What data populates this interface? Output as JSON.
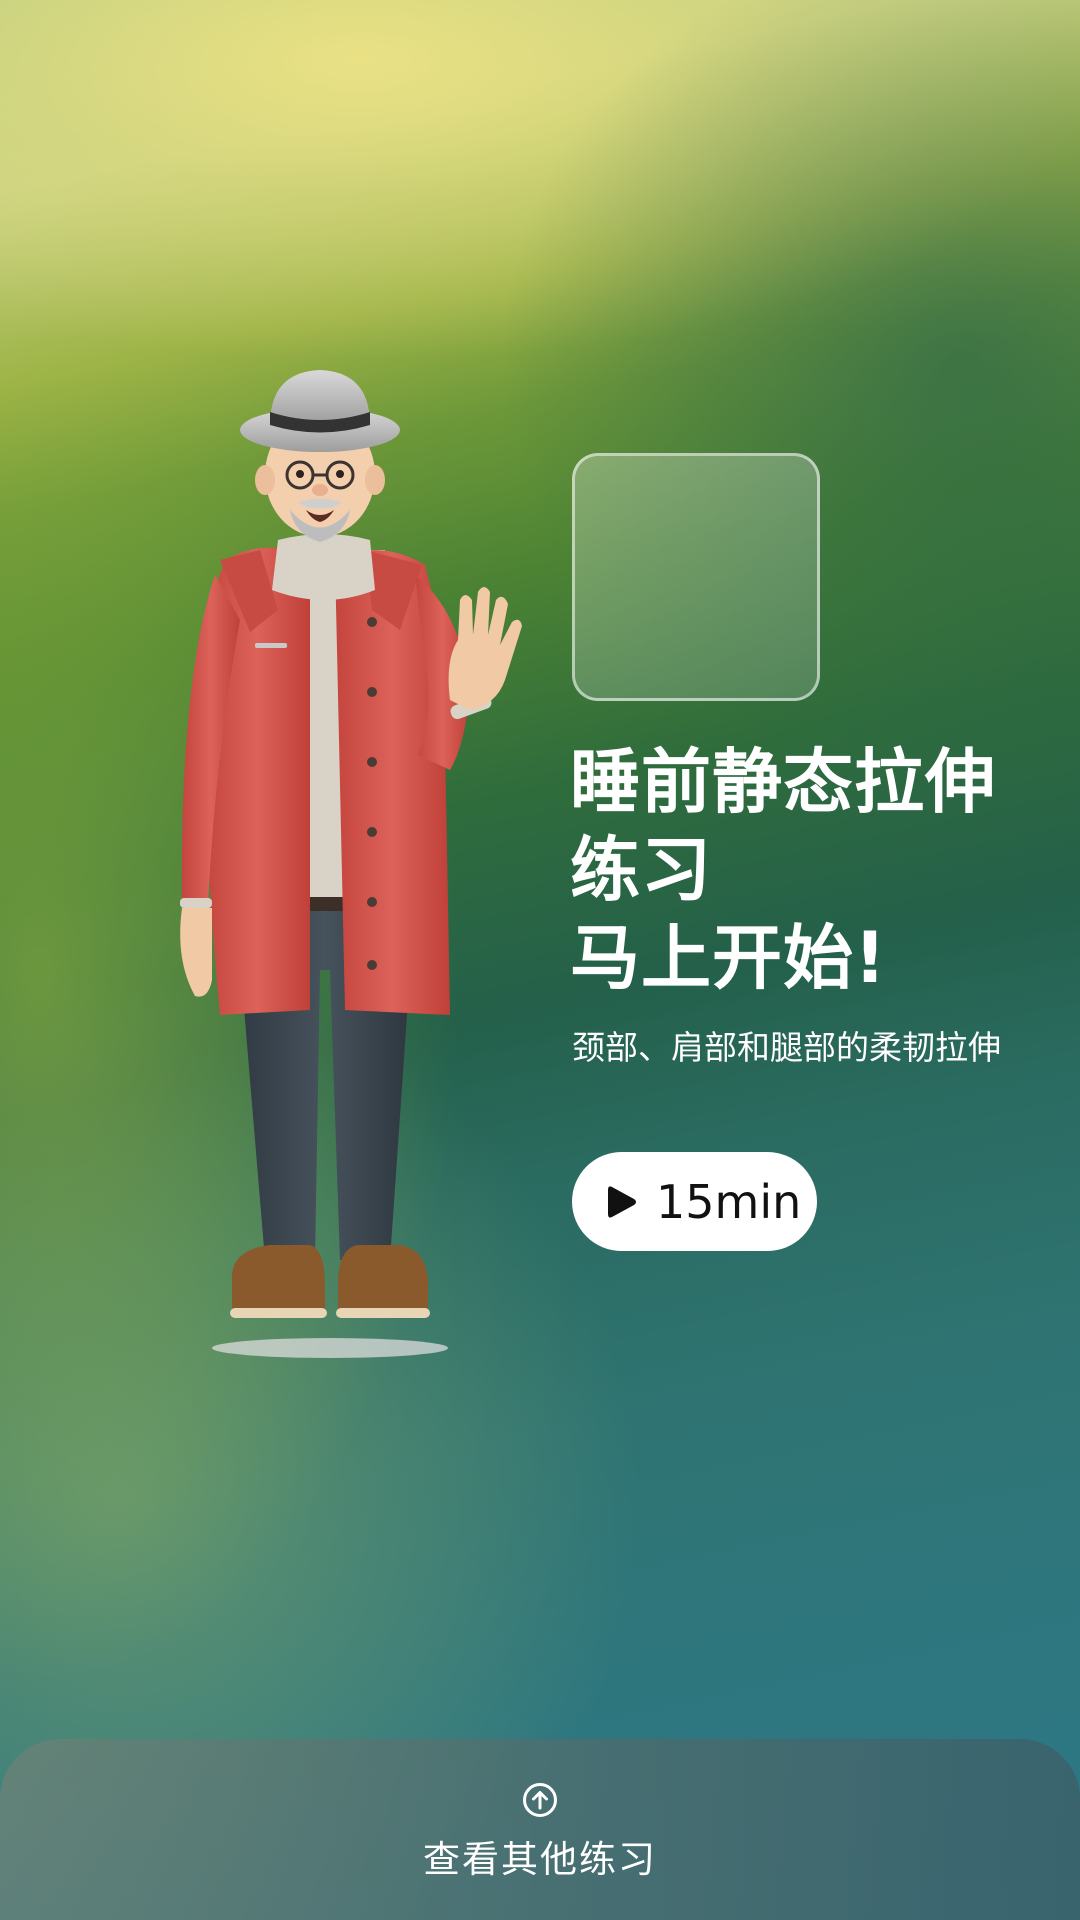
{
  "hero": {
    "title_line1": "睡前静态拉伸",
    "title_line2": "练习",
    "title_line3": "马上开始!",
    "subtitle": "颈部、肩部和腿部的柔韧拉伸"
  },
  "play_button": {
    "icon": "play-icon",
    "duration": "15min"
  },
  "bottom_sheet": {
    "icon": "arrow-up-circle-icon",
    "label": "查看其他练习"
  },
  "colors": {
    "text": "#ffffff",
    "button_bg": "#ffffff",
    "button_text": "#111111",
    "coat": "#d4584e",
    "pants": "#3a454e"
  }
}
